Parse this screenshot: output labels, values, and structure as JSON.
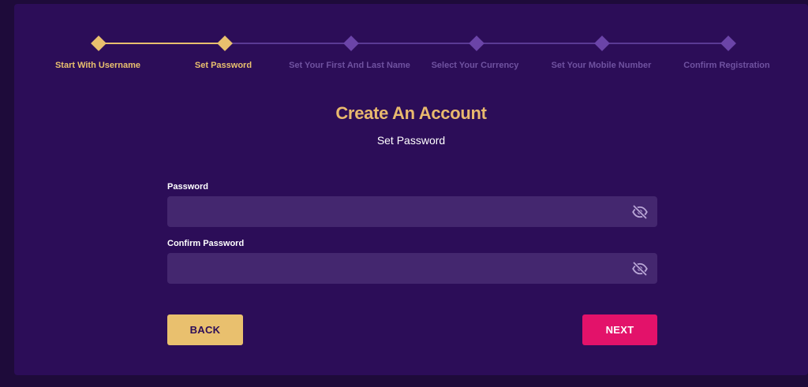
{
  "colors": {
    "page_bg": "#1e0b3a",
    "card_bg": "#2c0d58",
    "active": "#e9c06e",
    "inactive": "#6b44a8",
    "inactive_text": "#6f52a0",
    "field_bg": "#44276f",
    "next_button": "#e3126a"
  },
  "steps": [
    {
      "label": "Start With Username",
      "state": "done"
    },
    {
      "label": "Set Password",
      "state": "current"
    },
    {
      "label": "Set Your First And Last Name",
      "state": "pending"
    },
    {
      "label": "Select Your Currency",
      "state": "pending"
    },
    {
      "label": "Set Your Mobile Number",
      "state": "pending"
    },
    {
      "label": "Confirm Registration",
      "state": "pending"
    }
  ],
  "heading": {
    "title": "Create An Account",
    "subtitle": "Set Password"
  },
  "form": {
    "password": {
      "label": "Password",
      "value": "",
      "icon": "eye-off-icon"
    },
    "confirm_password": {
      "label": "Confirm Password",
      "value": "",
      "icon": "eye-off-icon"
    }
  },
  "buttons": {
    "back_label": "BACK",
    "next_label": "NEXT"
  }
}
